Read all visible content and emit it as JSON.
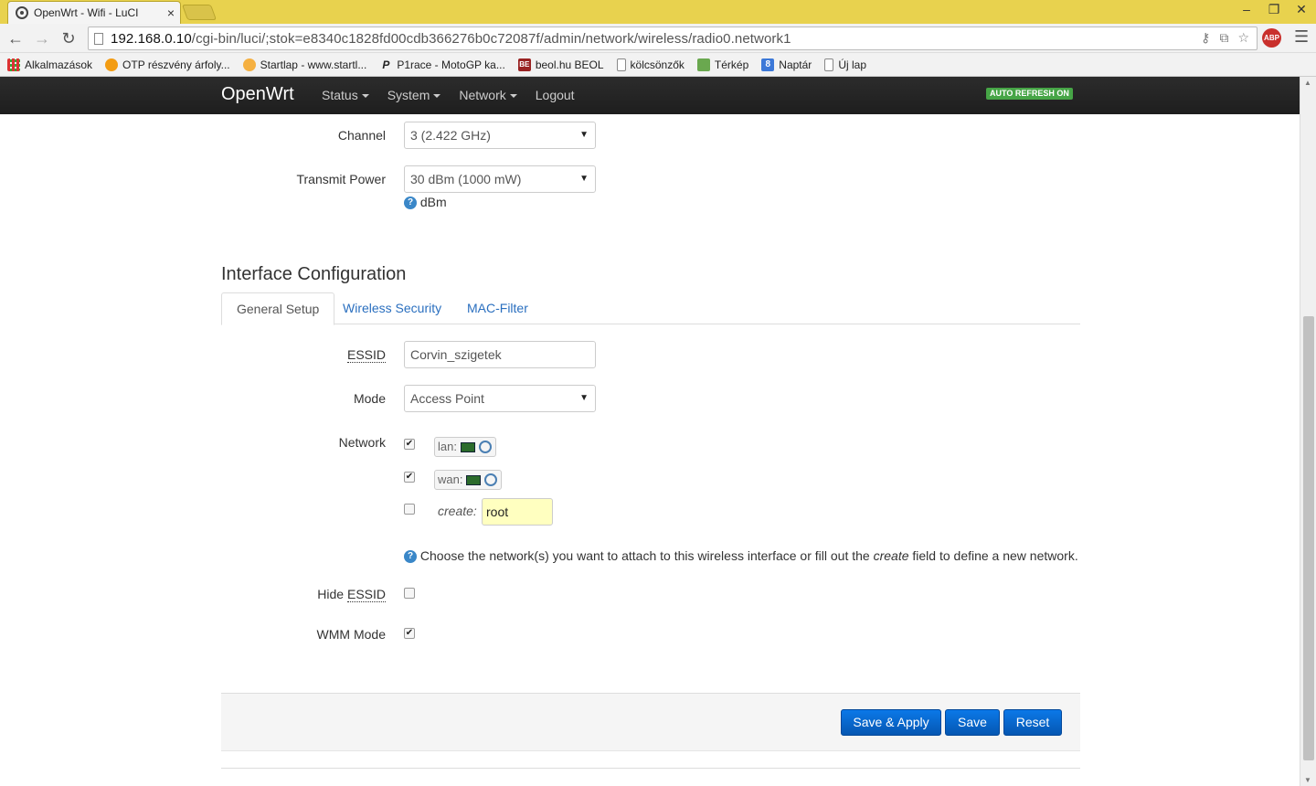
{
  "browser": {
    "tab_title": "OpenWrt - Wifi - LuCI",
    "tab_close": "×",
    "window_controls": {
      "minimize": "–",
      "restore": "❐",
      "close": "✕"
    },
    "url_host": "192.168.0.10",
    "url_path": "/cgi-bin/luci/;stok=e8340c1828fd00cdb366276b0c72087f/admin/network/wireless/radio0.network1",
    "abp_label": "ABP",
    "bookmarks": [
      {
        "label": "Alkalmazások",
        "icon": "apps-icon"
      },
      {
        "label": "OTP részvény árfoly...",
        "icon": "otp-icon"
      },
      {
        "label": "Startlap - www.startl...",
        "icon": "startlap-icon"
      },
      {
        "label": "P1race - MotoGP ka...",
        "icon": "p1race-icon"
      },
      {
        "label": "beol.hu BEOL",
        "icon": "beol-icon"
      },
      {
        "label": "kölcsönzők",
        "icon": "page-icon"
      },
      {
        "label": "Térkép",
        "icon": "map-icon"
      },
      {
        "label": "Naptár",
        "icon": "calendar-icon"
      },
      {
        "label": "Új lap",
        "icon": "page-icon"
      }
    ]
  },
  "navbar": {
    "brand": "OpenWrt",
    "menu": [
      "Status",
      "System",
      "Network",
      "Logout"
    ],
    "auto_refresh": "AUTO REFRESH ON"
  },
  "device": {
    "channel_label": "Channel",
    "channel_value": "3 (2.422 GHz)",
    "txpower_label": "Transmit Power",
    "txpower_value": "30 dBm (1000 mW)",
    "txpower_help": "dBm"
  },
  "interface": {
    "heading": "Interface Configuration",
    "tabs": [
      "General Setup",
      "Wireless Security",
      "MAC-Filter"
    ],
    "essid_label": "ESSID",
    "essid_value": "Corvin_szigetek",
    "mode_label": "Mode",
    "mode_value": "Access Point",
    "network_label": "Network",
    "networks": [
      {
        "name": "lan:",
        "checked": true
      },
      {
        "name": "wan:",
        "checked": true
      }
    ],
    "create_label": "create:",
    "create_value": "root",
    "network_help_pre": "Choose the network(s) you want to attach to this wireless interface or fill out the ",
    "network_help_em": "create",
    "network_help_post": " field to define a new network.",
    "hide_essid_label_pre": "Hide ",
    "hide_essid_label_abbr": "ESSID",
    "hide_essid_checked": false,
    "wmm_label": "WMM Mode",
    "wmm_checked": true
  },
  "actions": {
    "save_apply": "Save & Apply",
    "save": "Save",
    "reset": "Reset"
  },
  "colors": {
    "navbar_bg": "#222222",
    "button_primary": "#0069d6",
    "auto_refresh": "#46a546",
    "create_input_bg": "#ffffc0",
    "chrome_titlebar": "#e8d24e"
  }
}
